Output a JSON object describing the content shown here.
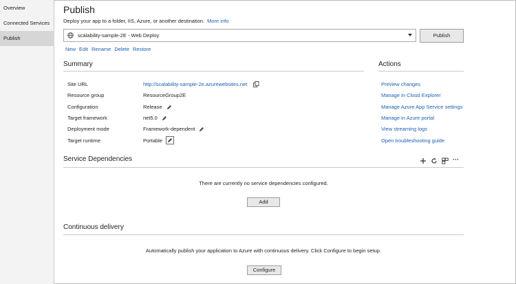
{
  "sidebar": {
    "items": [
      {
        "label": "Overview"
      },
      {
        "label": "Connected Services"
      },
      {
        "label": "Publish"
      }
    ]
  },
  "header": {
    "title": "Publish",
    "subtitle": "Deploy your app to a folder, IIS, Azure, or another destination.",
    "more_info": "More info"
  },
  "profile": {
    "selected": "scalability-sample-2E - Web Deploy",
    "publish_label": "Publish",
    "actions": [
      "New",
      "Edit",
      "Rename",
      "Delete",
      "Restore"
    ]
  },
  "summary": {
    "heading": "Summary",
    "rows": [
      {
        "label": "Site URL",
        "value": "http://scalability-sample-2e.azurewebsites.net"
      },
      {
        "label": "Resource group",
        "value": "ResourceGroup2E"
      },
      {
        "label": "Configuration",
        "value": "Release"
      },
      {
        "label": "Target framework",
        "value": "net5.0"
      },
      {
        "label": "Deployment mode",
        "value": "Framework-dependent"
      },
      {
        "label": "Target runtime",
        "value": "Portable"
      }
    ]
  },
  "actions": {
    "heading": "Actions",
    "links": [
      "Preview changes",
      "Manage in Cloud Explorer",
      "Manage Azure App Service settings",
      "Manage in Azure portal",
      "View streaming logs",
      "Open troubleshooting guide"
    ]
  },
  "service_dependencies": {
    "heading": "Service Dependencies",
    "empty_text": "There are currently no service dependencies configured.",
    "add_label": "Add",
    "more_glyph": "···"
  },
  "continuous_delivery": {
    "heading": "Continuous delivery",
    "text": "Automatically publish your application to Azure with continuous delivery. Click Configure to begin setup.",
    "configure_label": "Configure"
  },
  "colors": {
    "link": "#1a5fb4",
    "sidebar_bg": "#f3f3f3",
    "active_item": "#d6d6d6"
  }
}
